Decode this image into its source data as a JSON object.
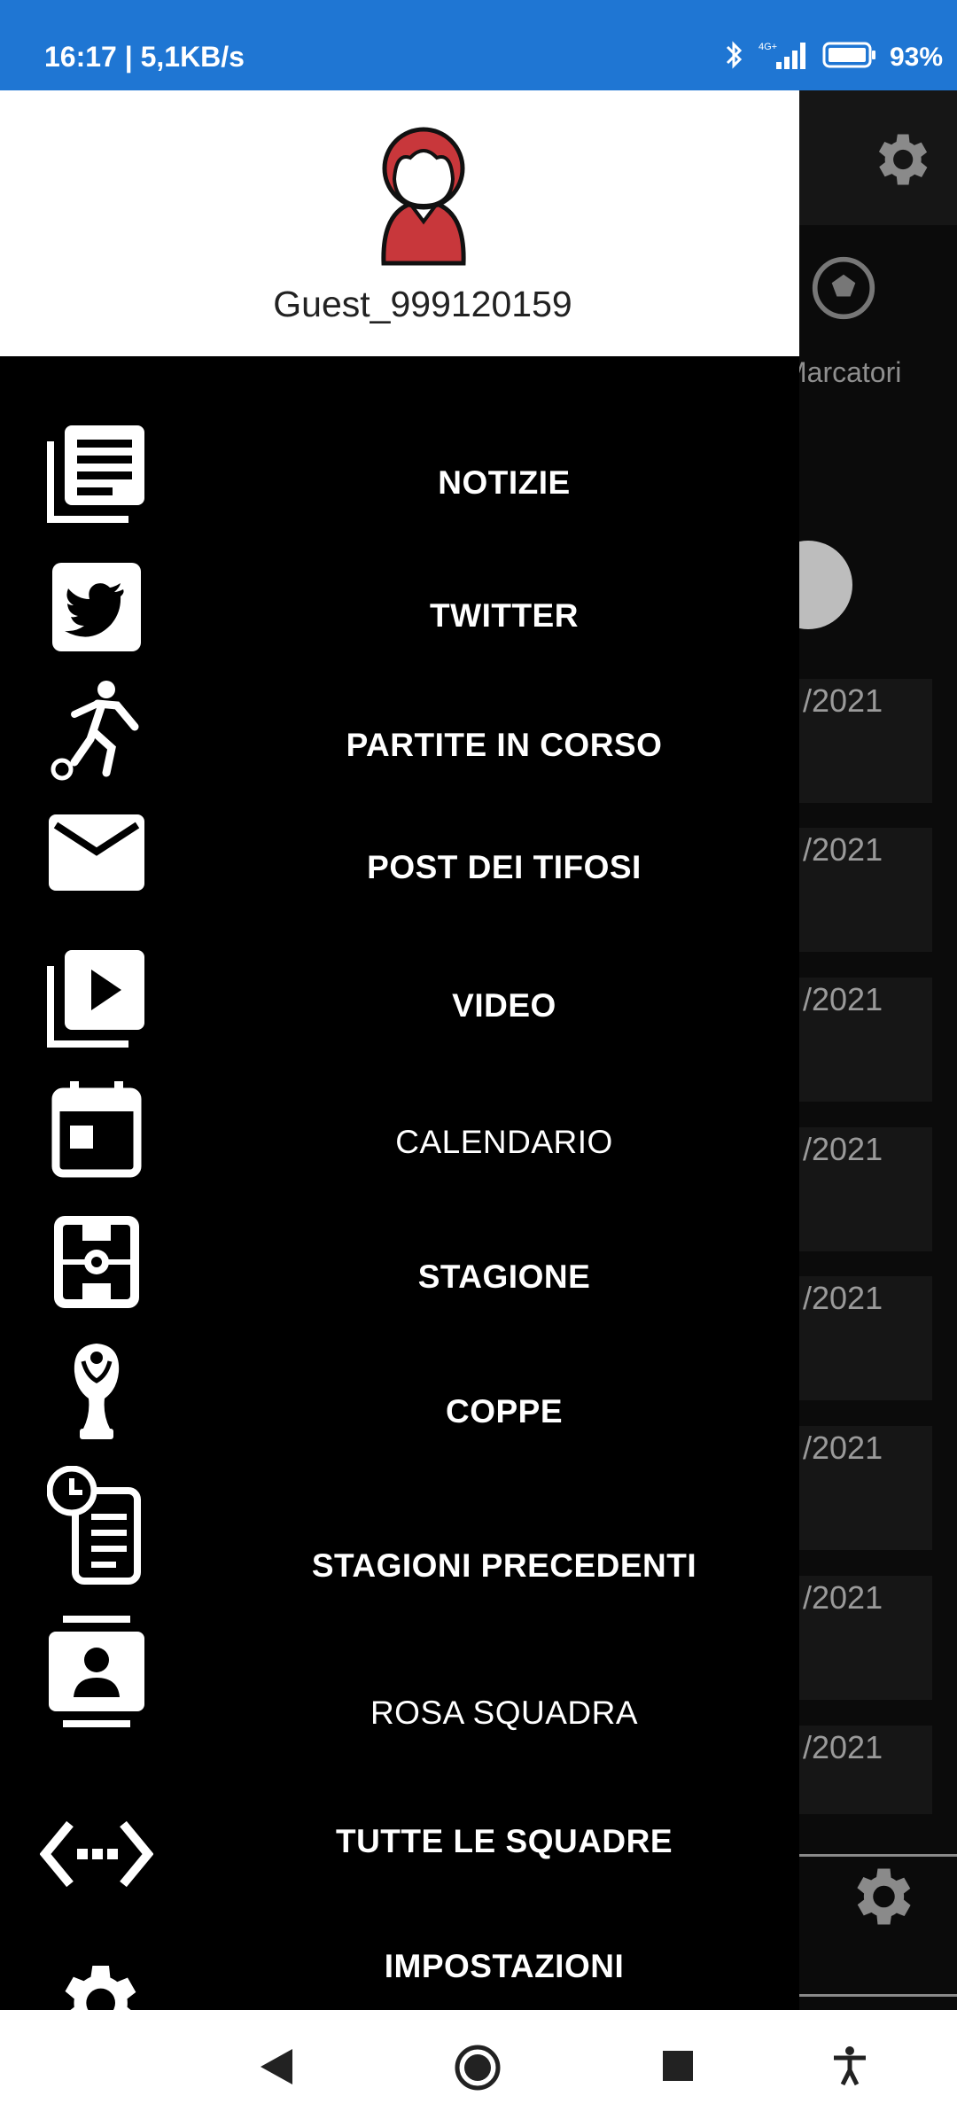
{
  "status_bar": {
    "time_speed": "16:17 | 5,1KB/s",
    "network": "4G+",
    "battery": "93%"
  },
  "drawer": {
    "username": "Guest_999120159",
    "items": [
      {
        "label": "NOTIZIE",
        "icon": "news-icon"
      },
      {
        "label": "TWITTER",
        "icon": "twitter-icon"
      },
      {
        "label": "PARTITE IN CORSO",
        "icon": "soccer-player-icon"
      },
      {
        "label": "POST DEI TIFOSI",
        "icon": "mail-icon"
      },
      {
        "label": "VIDEO",
        "icon": "video-library-icon"
      },
      {
        "label": "CALENDARIO",
        "icon": "calendar-icon"
      },
      {
        "label": "STAGIONE",
        "icon": "soccer-field-icon"
      },
      {
        "label": "COPPE",
        "icon": "trophy-icon"
      },
      {
        "label": "STAGIONI PRECEDENTI",
        "icon": "history-clipboard-icon"
      },
      {
        "label": "ROSA SQUADRA",
        "icon": "contact-card-icon"
      },
      {
        "label": "TUTTE LE SQUADRE",
        "icon": "code-arrows-icon"
      },
      {
        "label": "IMPOSTAZIONI",
        "icon": "settings-gear-icon"
      }
    ]
  },
  "background": {
    "tab_label": "Marcatori",
    "dates": [
      "/2021",
      "/2021",
      "/2021",
      "/2021",
      "/2021",
      "/2021",
      "/2021",
      "/2021"
    ]
  }
}
